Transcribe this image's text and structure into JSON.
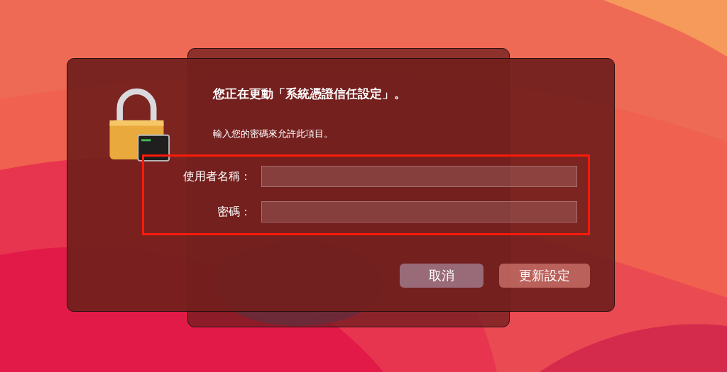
{
  "dialog": {
    "title": "您正在更動「系統憑證信任設定」。",
    "message": "輸入您的密碼來允許此項目。",
    "fields": [
      {
        "label": "使用者名稱："
      },
      {
        "label": "密碼："
      }
    ],
    "highlighted": true,
    "buttons": [
      {
        "label": "取消",
        "default": false
      },
      {
        "label": "更新設定",
        "default": true
      }
    ]
  }
}
